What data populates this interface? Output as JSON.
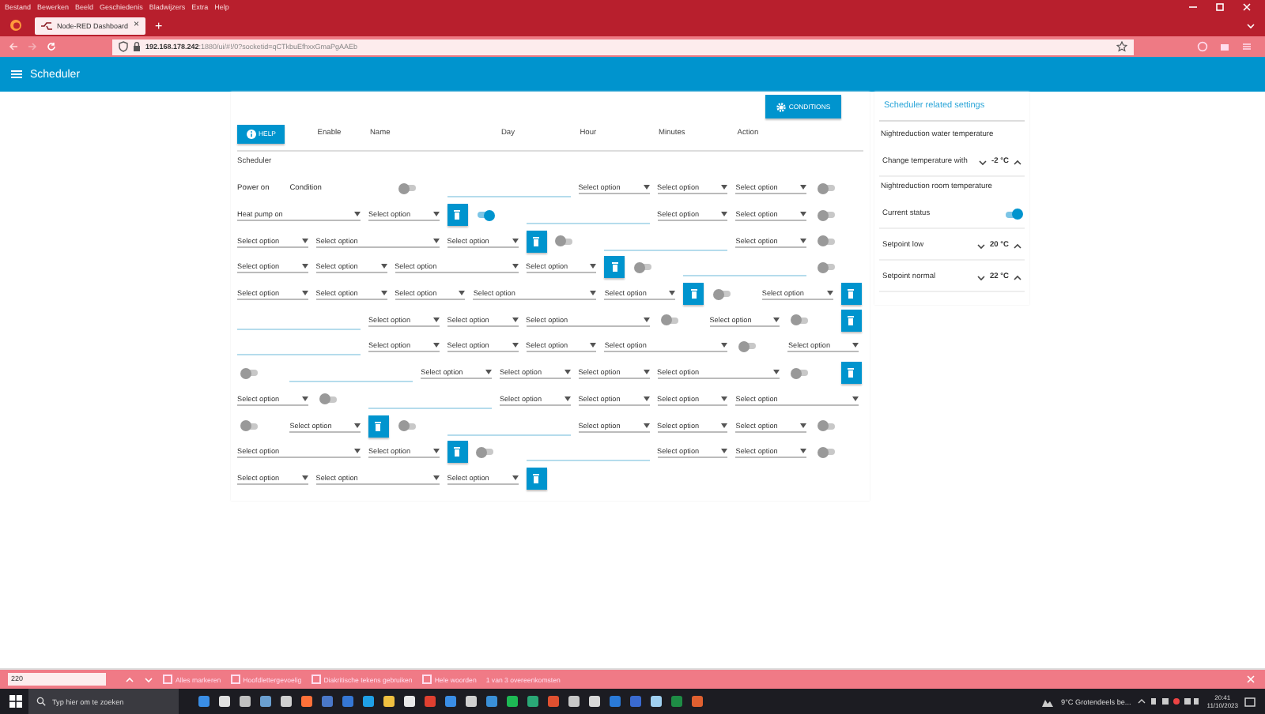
{
  "browser": {
    "menu": [
      "Bestand",
      "Bewerken",
      "Beeld",
      "Geschiedenis",
      "Bladwijzers",
      "Extra",
      "Help"
    ],
    "tab": {
      "title": "Node-RED Dashboard",
      "close": "×"
    },
    "new_tab": "+",
    "url": {
      "host": "192.168.178.242",
      "path": ":1880/ui/#!/0?socketid=qCTkbuEfhxxGmaPgAAEb"
    }
  },
  "header": {
    "title": "Scheduler"
  },
  "scheduler": {
    "conditions_button": "CONDITIONS",
    "help_button": "HELP",
    "header_labels": [
      "Enable",
      "Name",
      "Day",
      "Hour",
      "Minutes",
      "Action"
    ],
    "group_title": "Scheduler",
    "widgets": [
      {
        "kind": "text",
        "label": "Power on"
      },
      {
        "kind": "text",
        "label": "Condition"
      },
      {
        "kind": "toggle",
        "on": false
      },
      {
        "kind": "input"
      },
      {
        "kind": "select",
        "label": "Select option"
      },
      {
        "kind": "select",
        "label": "Select option"
      },
      {
        "kind": "select",
        "label": "Select option"
      },
      {
        "kind": "toggle",
        "on": false
      },
      {
        "kind": "select",
        "label": "Heat pump on"
      },
      {
        "kind": "select",
        "label": "Select option"
      },
      {
        "kind": "delete"
      },
      {
        "kind": "toggle",
        "on": true
      },
      {
        "kind": "input"
      },
      {
        "kind": "select",
        "label": "Select option"
      },
      {
        "kind": "select",
        "label": "Select option"
      },
      {
        "kind": "toggle",
        "on": false
      },
      {
        "kind": "select",
        "label": "Select option"
      },
      {
        "kind": "select",
        "label": "Select option"
      },
      {
        "kind": "select",
        "label": "Select option"
      },
      {
        "kind": "delete"
      },
      {
        "kind": "toggle",
        "on": false
      },
      {
        "kind": "input"
      },
      {
        "kind": "select",
        "label": "Select option"
      },
      {
        "kind": "toggle",
        "on": false
      },
      {
        "kind": "select",
        "label": "Select option"
      },
      {
        "kind": "select",
        "label": "Select option"
      },
      {
        "kind": "select",
        "label": "Select option"
      },
      {
        "kind": "select",
        "label": "Select option"
      },
      {
        "kind": "delete"
      },
      {
        "kind": "toggle",
        "on": false
      },
      {
        "kind": "input"
      },
      {
        "kind": "toggle",
        "on": false
      },
      {
        "kind": "select",
        "label": "Select option"
      },
      {
        "kind": "select",
        "label": "Select option"
      },
      {
        "kind": "select",
        "label": "Select option"
      },
      {
        "kind": "select",
        "label": "Select option"
      },
      {
        "kind": "select",
        "label": "Select option"
      },
      {
        "kind": "delete"
      },
      {
        "kind": "toggle",
        "on": false
      },
      {
        "kind": "select",
        "label": "Select option"
      },
      {
        "kind": "delete"
      },
      {
        "kind": "input"
      },
      {
        "kind": "select",
        "label": "Select option"
      },
      {
        "kind": "select",
        "label": "Select option"
      },
      {
        "kind": "select",
        "label": "Select option"
      },
      {
        "kind": "toggle",
        "on": false
      },
      {
        "kind": "select",
        "label": "Select option"
      },
      {
        "kind": "toggle",
        "on": false
      },
      {
        "kind": "delete"
      },
      {
        "kind": "input"
      },
      {
        "kind": "select",
        "label": "Select option"
      },
      {
        "kind": "select",
        "label": "Select option"
      },
      {
        "kind": "select",
        "label": "Select option"
      },
      {
        "kind": "select",
        "label": "Select option"
      },
      {
        "kind": "toggle",
        "on": false
      },
      {
        "kind": "select",
        "label": "Select option"
      },
      {
        "kind": "toggle",
        "on": false
      },
      {
        "kind": "input"
      },
      {
        "kind": "select",
        "label": "Select option"
      },
      {
        "kind": "select",
        "label": "Select option"
      },
      {
        "kind": "select",
        "label": "Select option"
      },
      {
        "kind": "select",
        "label": "Select option"
      },
      {
        "kind": "toggle",
        "on": false
      },
      {
        "kind": "delete"
      },
      {
        "kind": "select",
        "label": "Select option"
      },
      {
        "kind": "toggle",
        "on": false
      },
      {
        "kind": "input"
      },
      {
        "kind": "select",
        "label": "Select option"
      },
      {
        "kind": "select",
        "label": "Select option"
      },
      {
        "kind": "select",
        "label": "Select option"
      },
      {
        "kind": "select",
        "label": "Select option"
      },
      {
        "kind": "toggle",
        "on": false
      },
      {
        "kind": "select",
        "label": "Select option"
      },
      {
        "kind": "delete"
      },
      {
        "kind": "toggle",
        "on": false
      },
      {
        "kind": "input"
      },
      {
        "kind": "select",
        "label": "Select option"
      },
      {
        "kind": "select",
        "label": "Select option"
      },
      {
        "kind": "select",
        "label": "Select option"
      },
      {
        "kind": "toggle",
        "on": false
      },
      {
        "kind": "select",
        "label": "Select option"
      },
      {
        "kind": "select",
        "label": "Select option"
      },
      {
        "kind": "delete"
      },
      {
        "kind": "toggle",
        "on": false
      },
      {
        "kind": "input"
      },
      {
        "kind": "select",
        "label": "Select option"
      },
      {
        "kind": "select",
        "label": "Select option"
      },
      {
        "kind": "toggle",
        "on": false
      },
      {
        "kind": "select",
        "label": "Select option"
      },
      {
        "kind": "select",
        "label": "Select option"
      },
      {
        "kind": "select",
        "label": "Select option"
      },
      {
        "kind": "delete"
      }
    ]
  },
  "settings": {
    "title": "Scheduler related settings",
    "items": [
      {
        "kind": "heading",
        "label": "Nightreduction water temperature"
      },
      {
        "kind": "numeric",
        "label": "Change temperature with",
        "value": "-2 °C"
      },
      {
        "kind": "heading",
        "label": "Nightreduction room temperature"
      },
      {
        "kind": "switch",
        "label": "Current status",
        "on": true
      },
      {
        "kind": "numeric",
        "label": "Setpoint low",
        "value": "20 °C"
      },
      {
        "kind": "numeric",
        "label": "Setpoint normal",
        "value": "22 °C"
      }
    ]
  },
  "find_bar": {
    "query": "220",
    "options": [
      {
        "label": "Alles markeren",
        "checked": false
      },
      {
        "label": "Hoofdlettergevoelig",
        "checked": false
      },
      {
        "label": "Diakritische tekens gebruiken",
        "checked": false
      },
      {
        "label": "Hele woorden",
        "checked": false
      }
    ],
    "result": "1 van 3 overeenkomsten"
  },
  "taskbar": {
    "search_placeholder": "Typ hier om te zoeken",
    "weather": "9°C  Grotendeels be...",
    "time": "20:41",
    "date": "11/10/2023"
  }
}
